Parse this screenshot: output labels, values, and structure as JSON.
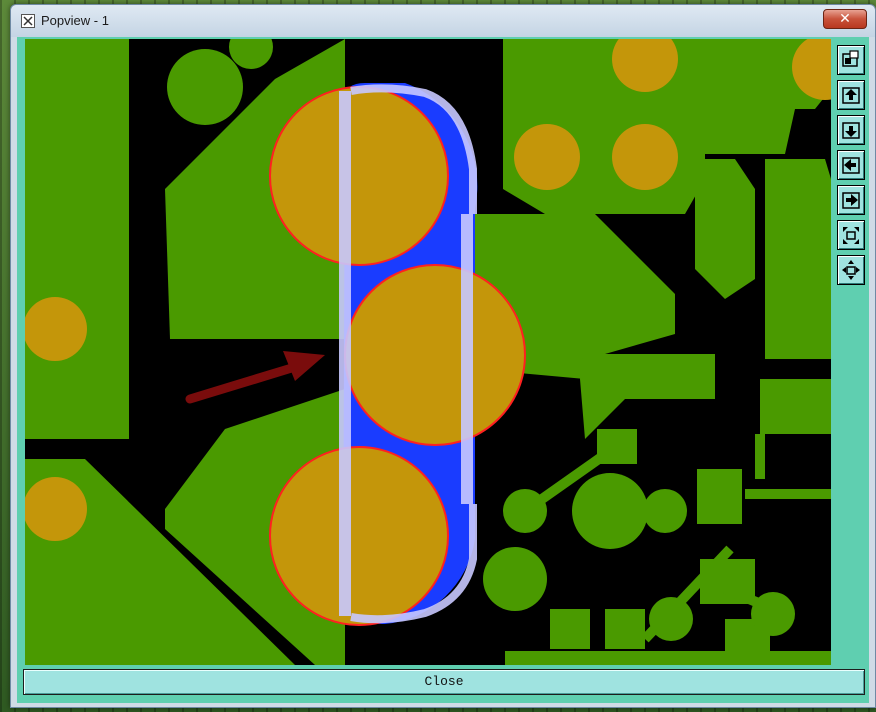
{
  "window": {
    "title": "Popview - 1",
    "close_glyph": "✕"
  },
  "toolbar": {
    "buttons": [
      {
        "icon": "zoom-window-icon"
      },
      {
        "icon": "zoom-in-icon"
      },
      {
        "icon": "zoom-out-icon"
      },
      {
        "icon": "pan-left-icon"
      },
      {
        "icon": "pan-right-icon"
      },
      {
        "icon": "fit-all-icon"
      },
      {
        "icon": "pan-center-icon"
      }
    ]
  },
  "footer": {
    "close_label": "Close"
  },
  "colors": {
    "copper": "#4a9a00",
    "pad": "#c4960a",
    "background": "#000000",
    "highlight_outline": "#1a3cff",
    "highlight_inner": "#c8c8ff",
    "pad_outline": "#ff2020",
    "arrow": "#7a0c0c",
    "client_bg": "#5fcfb0",
    "button_bg": "#9fe3e0"
  }
}
